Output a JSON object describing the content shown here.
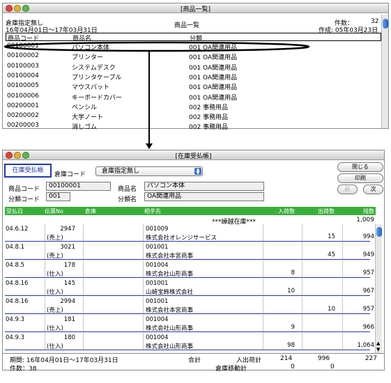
{
  "top_window": {
    "title": "[商品一覧]",
    "filter_label": "倉庫指定無し",
    "period": "16年04月01日～17年03月31日",
    "center_title": "商品一覧",
    "count_label": "件数：",
    "count_value": "32",
    "created": "作成: 05年03月23日",
    "columns": [
      "商品コード",
      "商品名",
      "分類"
    ],
    "rows": [
      {
        "code": "00100001",
        "name": "パソコン本体",
        "cat": "001 OA関連用品"
      },
      {
        "code": "00100002",
        "name": "プリンター",
        "cat": "001 OA関連用品"
      },
      {
        "code": "00100003",
        "name": "システムデスク",
        "cat": "001 OA関連用品"
      },
      {
        "code": "00100004",
        "name": "プリンタケーブル",
        "cat": "001 OA関連用品"
      },
      {
        "code": "00100005",
        "name": "マウスパット",
        "cat": "001 OA関連用品"
      },
      {
        "code": "00100006",
        "name": "キーボードカバー",
        "cat": "001 OA関連用品"
      },
      {
        "code": "00200001",
        "name": "ペンシル",
        "cat": "002 事務用品"
      },
      {
        "code": "00200002",
        "name": "大学ノート",
        "cat": "002 事務用品"
      },
      {
        "code": "00200003",
        "name": "消しゴム",
        "cat": "002 事務用品"
      }
    ]
  },
  "bottom_window": {
    "title": "[在庫受払帳]",
    "tab_label": "在庫受払帳",
    "warehouse_label": "倉庫コード",
    "warehouse_select": "倉庫指定無し",
    "buttons": {
      "close": "閉じる",
      "print": "印刷",
      "prev": "前",
      "next": "次"
    },
    "product_code_label": "商品コード",
    "product_code": "00100001",
    "product_name_label": "商品名",
    "product_name": "パソコン本体",
    "category_code_label": "分類コード",
    "category_code": "001",
    "category_name_label": "分類名",
    "category_name": "OA関連用品",
    "columns": {
      "date": "受払日",
      "voucher": "伝票No",
      "warehouse": "倉庫",
      "partner": "相手先",
      "in": "入荷数",
      "out": "出荷数",
      "balance": "残数"
    },
    "carry_label": "***繰越在庫***",
    "carry_value": "1,009",
    "rows": [
      {
        "date": "04.6.12",
        "no": "2947",
        "type": "(売上)",
        "pcode": "001009",
        "pname": "株式会社オレンジサービス",
        "in": "",
        "out": "15",
        "bal": "994"
      },
      {
        "date": "04.8.1",
        "no": "3021",
        "type": "(売上)",
        "pcode": "001001",
        "pname": "株式会社本宮商事",
        "in": "",
        "out": "45",
        "bal": "949"
      },
      {
        "date": "04.8.5",
        "no": "178",
        "type": "(仕入)",
        "pcode": "001004",
        "pname": "株式会社山形商事",
        "in": "8",
        "out": "",
        "bal": "957"
      },
      {
        "date": "04.8.16",
        "no": "145",
        "type": "(仕入)",
        "pcode": "001001",
        "pname": "山崎宝飾株式会社",
        "in": "10",
        "out": "",
        "bal": "967"
      },
      {
        "date": "04.8.16",
        "no": "2994",
        "type": "(売上)",
        "pcode": "001001",
        "pname": "株式会社本宮商事",
        "in": "",
        "out": "10",
        "bal": "957"
      },
      {
        "date": "04.9.3",
        "no": "181",
        "type": "(仕入)",
        "pcode": "001004",
        "pname": "株式会社山形商事",
        "in": "9",
        "out": "",
        "bal": "966"
      },
      {
        "date": "04.9.3",
        "no": "180",
        "type": "(仕入)",
        "pcode": "001004",
        "pname": "株式会社山形商事",
        "in": "98",
        "out": "",
        "bal": "1,064"
      }
    ],
    "footer": {
      "period": "期間: 16年04月01日～17年03月31日",
      "count": "件数：38",
      "total_label": "合計",
      "inout_label": "入出荷計",
      "in_total": "214",
      "out_total": "996",
      "bal_total": "227",
      "transfer_label": "倉庫移動計",
      "transfer_in": "0",
      "transfer_out": "0"
    }
  },
  "colors": {
    "header_green": "#3aae3a",
    "row_border": "#1f3aa8",
    "tab_border": "#1f3aa8"
  }
}
